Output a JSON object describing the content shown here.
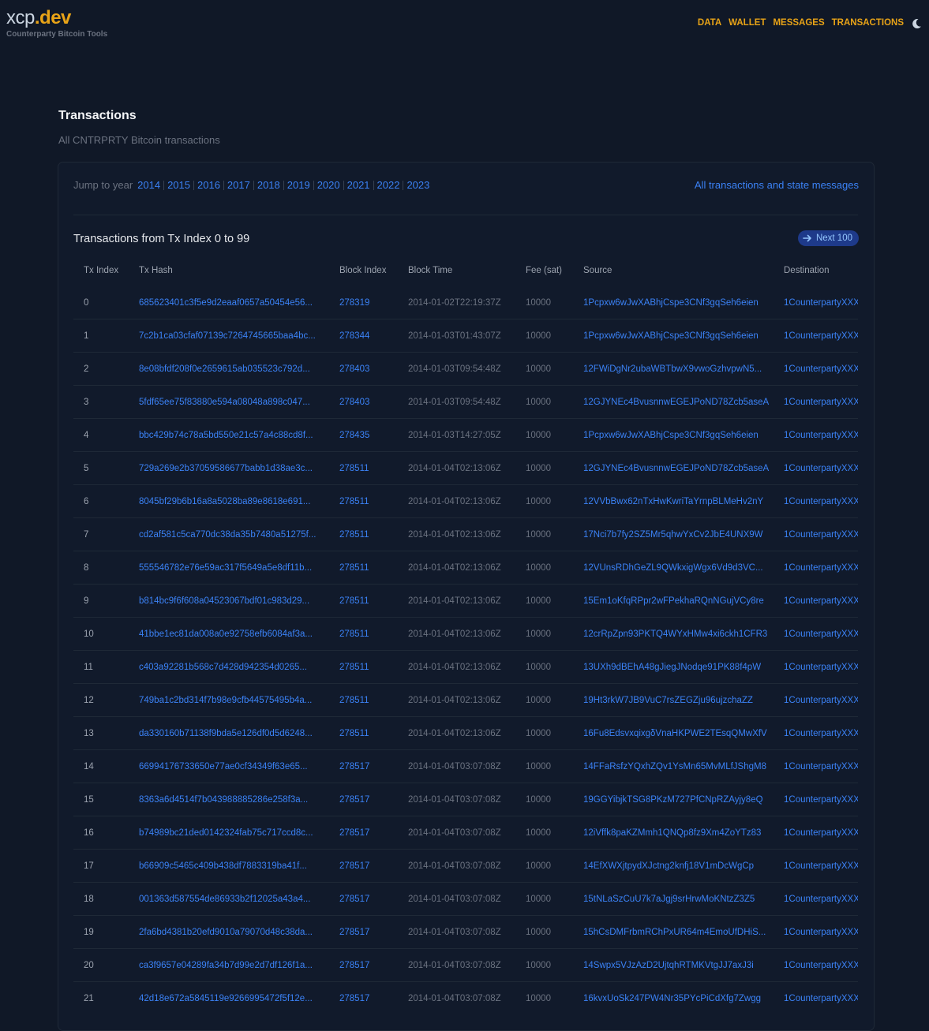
{
  "header": {
    "logo_part1": "xcp",
    "logo_part2": ".dev",
    "tagline": "Counterparty Bitcoin Tools",
    "nav": [
      "DATA",
      "WALLET",
      "MESSAGES",
      "TRANSACTIONS"
    ]
  },
  "page": {
    "title": "Transactions",
    "subtitle": "All CNTRPRTY Bitcoin transactions"
  },
  "jump": {
    "label": "Jump to year",
    "years": [
      "2014",
      "2015",
      "2016",
      "2017",
      "2018",
      "2019",
      "2020",
      "2021",
      "2022",
      "2023"
    ],
    "all_link": "All transactions and state messages"
  },
  "table": {
    "title": "Transactions from Tx Index 0 to 99",
    "next_label": "Next 100",
    "columns": [
      "Tx Index",
      "Tx Hash",
      "Block Index",
      "Block Time",
      "Fee (sat)",
      "Source",
      "Destination"
    ],
    "rows": [
      [
        "0",
        "685623401c3f5e9d2eaaf0657a50454e56...",
        "278319",
        "2014-01-02T22:19:37Z",
        "10000",
        "1Pcpxw6wJwXABhjCspe3CNf3gqSeh6eien",
        "1CounterpartyXXX"
      ],
      [
        "1",
        "7c2b1ca03cfaf07139c7264745665baa4bc...",
        "278344",
        "2014-01-03T01:43:07Z",
        "10000",
        "1Pcpxw6wJwXABhjCspe3CNf3gqSeh6eien",
        "1CounterpartyXXX"
      ],
      [
        "2",
        "8e08bfdf208f0e2659615ab035523c792d...",
        "278403",
        "2014-01-03T09:54:48Z",
        "10000",
        "12FWiDgNr2ubaWBTbwX9vwoGzhvpwN5...",
        "1CounterpartyXXX"
      ],
      [
        "3",
        "5fdf65ee75f83880e594a08048a898c047...",
        "278403",
        "2014-01-03T09:54:48Z",
        "10000",
        "12GJYNEc4BvusnnwEGEJPoND78Zcb5aseA",
        "1CounterpartyXXX"
      ],
      [
        "4",
        "bbc429b74c78a5bd550e21c57a4c88cd8f...",
        "278435",
        "2014-01-03T14:27:05Z",
        "10000",
        "1Pcpxw6wJwXABhjCspe3CNf3gqSeh6eien",
        "1CounterpartyXXX"
      ],
      [
        "5",
        "729a269e2b37059586677babb1d38ae3c...",
        "278511",
        "2014-01-04T02:13:06Z",
        "10000",
        "12GJYNEc4BvusnnwEGEJPoND78Zcb5aseA",
        "1CounterpartyXXX"
      ],
      [
        "6",
        "8045bf29b6b16a8a5028ba89e8618e691...",
        "278511",
        "2014-01-04T02:13:06Z",
        "10000",
        "12VVbBwx62nTxHwKwriTaYrnpBLMeHv2nY",
        "1CounterpartyXXX"
      ],
      [
        "7",
        "cd2af581c5ca770dc38da35b7480a51275f...",
        "278511",
        "2014-01-04T02:13:06Z",
        "10000",
        "17Nci7b7fy2SZ5Mr5qhwYxCv2JbE4UNX9W",
        "1CounterpartyXXX"
      ],
      [
        "8",
        "555546782e76e59ac317f5649a5e8df11b...",
        "278511",
        "2014-01-04T02:13:06Z",
        "10000",
        "12VUnsRDhGeZL9QWkxigWgx6Vd9d3VC...",
        "1CounterpartyXXX"
      ],
      [
        "9",
        "b814bc9f6f608a04523067bdf01c983d29...",
        "278511",
        "2014-01-04T02:13:06Z",
        "10000",
        "15Em1oKfqRPpr2wFPekhaRQnNGujVCy8re",
        "1CounterpartyXXX"
      ],
      [
        "10",
        "41bbe1ec81da008a0e92758efb6084af3a...",
        "278511",
        "2014-01-04T02:13:06Z",
        "10000",
        "12crRpZpn93PKTQ4WYxHMw4xi6ckh1CFR3",
        "1CounterpartyXXX"
      ],
      [
        "11",
        "c403a92281b568c7d428d942354d0265...",
        "278511",
        "2014-01-04T02:13:06Z",
        "10000",
        "13UXh9dBEhA48gJiegJNodqe91PK88f4pW",
        "1CounterpartyXXX"
      ],
      [
        "12",
        "749ba1c2bd314f7b98e9cfb44575495b4a...",
        "278511",
        "2014-01-04T02:13:06Z",
        "10000",
        "19Ht3rkW7JB9VuC7rsZEGZju96ujzchaZZ",
        "1CounterpartyXXX"
      ],
      [
        "13",
        "da330160b71138f9bda5e126df0d5d6248...",
        "278511",
        "2014-01-04T02:13:06Z",
        "10000",
        "16Fu8EdsvxqixgδVnaHKPWE2TEsqQMwXfV",
        "1CounterpartyXXX"
      ],
      [
        "14",
        "66994176733650e77ae0cf34349f63e65...",
        "278517",
        "2014-01-04T03:07:08Z",
        "10000",
        "14FFaRsfzYQxhZQv1YsMn65MvMLfJShgM8",
        "1CounterpartyXXX"
      ],
      [
        "15",
        "8363a6d4514f7b043988885286e258f3a...",
        "278517",
        "2014-01-04T03:07:08Z",
        "10000",
        "19GGYibjkTSG8PKzM727PfCNpRZAyjy8eQ",
        "1CounterpartyXXX"
      ],
      [
        "16",
        "b74989bc21ded0142324fab75c717ccd8c...",
        "278517",
        "2014-01-04T03:07:08Z",
        "10000",
        "12iVffk8paKZMmh1QNQp8fz9Xm4ZoYTz83",
        "1CounterpartyXXX"
      ],
      [
        "17",
        "b66909c5465c409b438df7883319ba41f...",
        "278517",
        "2014-01-04T03:07:08Z",
        "10000",
        "14EfXWXjtpydXJctng2knfj18V1mDcWgCp",
        "1CounterpartyXXX"
      ],
      [
        "18",
        "001363d587554de86933b2f12025a43a4...",
        "278517",
        "2014-01-04T03:07:08Z",
        "10000",
        "15tNLaSzCuU7k7aJgj9srHrwMoKNtzZ3Z5",
        "1CounterpartyXXX"
      ],
      [
        "19",
        "2fa6bd4381b20efd9010a79070d48c38da...",
        "278517",
        "2014-01-04T03:07:08Z",
        "10000",
        "15hCsDMFrbmRChPxUR64m4EmoUfDHiS...",
        "1CounterpartyXXX"
      ],
      [
        "20",
        "ca3f9657e04289fa34b7d99e2d7df126f1a...",
        "278517",
        "2014-01-04T03:07:08Z",
        "10000",
        "14Swpx5VJzAzD2UjtqhRTMKVtgJJ7axJ3i",
        "1CounterpartyXXX"
      ],
      [
        "21",
        "42d18e672a5845119e9266995472f5f12e...",
        "278517",
        "2014-01-04T03:07:08Z",
        "10000",
        "16kvxUoSk247PW4Nr35PYcPiCdXfg7Zwgg",
        "1CounterpartyXXX"
      ]
    ]
  }
}
